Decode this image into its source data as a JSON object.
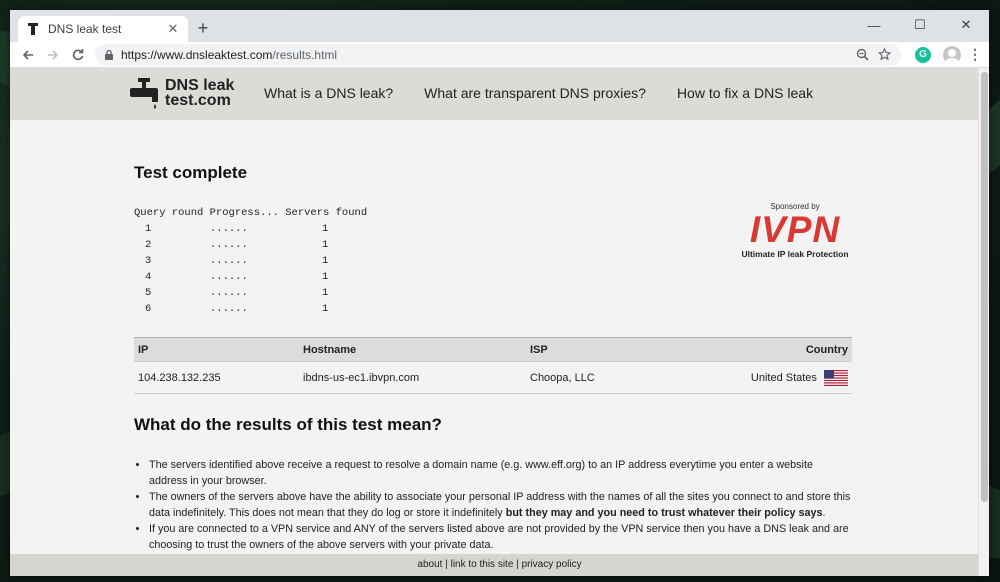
{
  "browser": {
    "tab_title": "DNS leak test",
    "tab_close": "✕",
    "new_tab": "+",
    "url_host": "https://www.dnsleaktest.com",
    "url_path": "/results.html",
    "extension_letter": "G",
    "controls": {
      "minimize": "—",
      "maximize": "☐",
      "close": "✕"
    }
  },
  "header": {
    "logo_line1": "DNS leak",
    "logo_line2": "test.com",
    "nav": [
      {
        "label": "What is a DNS leak?"
      },
      {
        "label": "What are transparent DNS proxies?"
      },
      {
        "label": "How to fix a DNS leak"
      }
    ]
  },
  "test": {
    "title": "Test complete",
    "header_row": "Query round Progress... Servers found",
    "rounds": [
      {
        "round": "1",
        "progress": "......",
        "servers": "1"
      },
      {
        "round": "2",
        "progress": "......",
        "servers": "1"
      },
      {
        "round": "3",
        "progress": "......",
        "servers": "1"
      },
      {
        "round": "4",
        "progress": "......",
        "servers": "1"
      },
      {
        "round": "5",
        "progress": "......",
        "servers": "1"
      },
      {
        "round": "6",
        "progress": "......",
        "servers": "1"
      }
    ]
  },
  "sponsor": {
    "by": "Sponsored by",
    "brand": "IVPN",
    "tagline": "Ultimate IP leak Protection",
    "brand_color": "#d83a33"
  },
  "results": {
    "headers": {
      "ip": "IP",
      "hostname": "Hostname",
      "isp": "ISP",
      "country": "Country"
    },
    "rows": [
      {
        "ip": "104.238.132.235",
        "hostname": "ibdns-us-ec1.ibvpn.com",
        "isp": "Choopa, LLC",
        "country": "United States",
        "flag_icon": "us-flag-icon"
      }
    ]
  },
  "meaning": {
    "title": "What do the results of this test mean?",
    "b1": "The servers identified above receive a request to resolve a domain name (e.g. www.eff.org) to an IP address everytime you enter a website address in your browser.",
    "b2_pre": "The owners of the servers above have the ability to associate your personal IP address with the names of all the sites you connect to and store this data indefinitely. This does not mean that they do log or store it indefinitely ",
    "b2_bold": "but they may and you need to trust whatever their policy says",
    "b2_post": ".",
    "b3": "If you are connected to a VPN service and ANY of the servers listed above are not provided by the VPN service then you have a DNS leak and are choosing to trust the owners of the above servers with your private data."
  },
  "footer": {
    "about": "about",
    "sep1": " | ",
    "link": "link to this site",
    "sep2": " | ",
    "privacy": "privacy policy"
  }
}
